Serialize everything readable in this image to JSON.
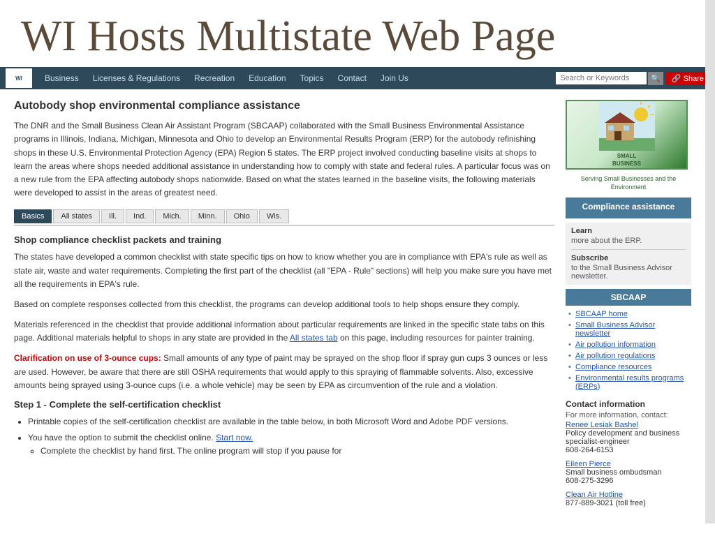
{
  "page": {
    "title": "WI Hosts Multistate Web Page"
  },
  "navbar": {
    "logo_text": "WI",
    "links": [
      {
        "label": "Business",
        "href": "#"
      },
      {
        "label": "Licenses & Regulations",
        "href": "#"
      },
      {
        "label": "Recreation",
        "href": "#"
      },
      {
        "label": "Education",
        "href": "#"
      },
      {
        "label": "Topics",
        "href": "#"
      },
      {
        "label": "Contact",
        "href": "#"
      },
      {
        "label": "Join Us",
        "href": "#"
      }
    ],
    "search_placeholder": "Search or Keywords",
    "search_btn_label": "🔍",
    "share_btn_label": "🔗 Share"
  },
  "content": {
    "heading": "Autobody shop environmental compliance assistance",
    "intro": "The DNR and the Small Business Clean Air Assistant Program (SBCAAP) collaborated with the Small Business Environmental Assistance programs in Illinois, Indiana, Michigan, Minnesota and Ohio to develop an Environmental Results Program (ERP) for the autobody refinishing shops in these U.S. Environmental Protection Agency (EPA) Region 5 states. The ERP project involved conducting baseline visits at shops to learn the areas where shops needed additional assistance in understanding how to comply with state and federal rules. A particular focus was on a new rule from the EPA affecting autobody shops nationwide. Based on what the states learned in the baseline visits, the following materials were developed to assist in the areas of greatest need.",
    "tabs": [
      {
        "label": "Basics",
        "active": true
      },
      {
        "label": "All states"
      },
      {
        "label": "Ill."
      },
      {
        "label": "Ind."
      },
      {
        "label": "Mich."
      },
      {
        "label": "Minn."
      },
      {
        "label": "Ohio"
      },
      {
        "label": "Wis."
      }
    ],
    "section1_title": "Shop compliance checklist packets and training",
    "section1_text1": "The states have developed a common checklist with state specific tips on how to know whether you are in compliance with EPA's rule as well as state air, waste and water requirements. Completing the first part of the checklist (all \"EPA - Rule\" sections) will help you make sure you have met all the requirements in EPA's rule.",
    "section1_text2": "Based on complete responses collected from this checklist, the programs can develop additional tools to help shops ensure they comply.",
    "section1_text3": "Materials referenced in the checklist that provide additional information about particular requirements are linked in the specific state tabs on this page. Additional materials helpful to shops in any state are provided in the",
    "all_states_link": "All states tab",
    "section1_text3b": "on this page, including resources for painter training.",
    "warning_label": "Clarification on use of 3-ounce cups:",
    "warning_text": "Small amounts of any type of paint may be sprayed on the shop floor if spray gun cups 3 ounces or less are used. However, be aware that there are still OSHA requirements that would apply to this spraying of flammable solvents. Also, excessive amounts being sprayed using 3-ounce cups (i.e. a whole vehicle) may be seen by EPA as circumvention of the rule and a violation.",
    "section2_title": "Step 1 - Complete the self-certification checklist",
    "section2_bullets": [
      "Printable copies of the self-certification checklist are available in the table below, in both Microsoft Word and Adobe PDF versions.",
      "You have the option to submit the checklist online."
    ],
    "start_now_link": "Start now.",
    "section2_subbullet": "Complete the checklist by hand first. The online program will stop if you pause for"
  },
  "sidebar": {
    "logo_alt": "Small Business Environmental Assistance Program",
    "logo_tagline": "Serving Small Businesses and the Environment",
    "compliance_title": "Compliance assistance",
    "learn_label": "Learn",
    "learn_sub": "more about the ERP.",
    "subscribe_label": "Subscribe",
    "subscribe_sub": "to the Small Business Advisor newsletter.",
    "sbcaap_title": "SBCAAP",
    "sbcaap_links": [
      "SBCAAP home",
      "Small Business Advisor newsletter",
      "Air pollution information",
      "Air pollution regulations",
      "Compliance resources",
      "Environmental results programs (ERPs)"
    ],
    "contact_title": "Contact information",
    "contact_sub": "For more information, contact:",
    "contacts": [
      {
        "name": "Renee Lesiak Bashel",
        "role": "Policy development and business specialist-engineer",
        "phone": "608-264-6153"
      },
      {
        "name": "Eileen Pierce",
        "role": "Small business ombudsman",
        "phone": "608-275-3296"
      },
      {
        "name": "Clean Air Hotline",
        "role": "",
        "phone": "877-889-3021 (toll free)"
      }
    ]
  }
}
